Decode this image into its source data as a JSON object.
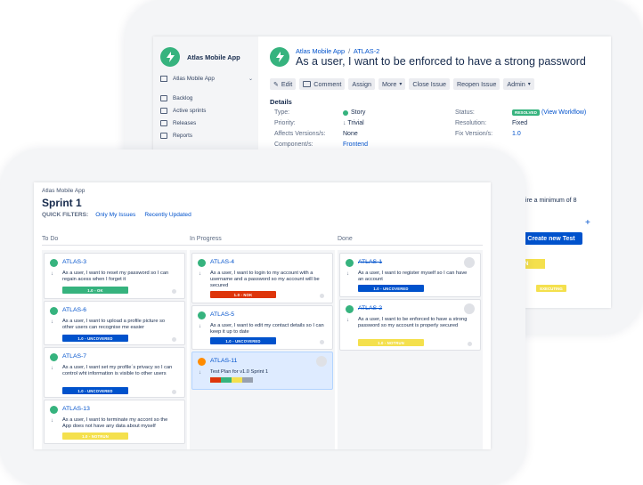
{
  "issue_view": {
    "project_name": "Atlas Mobile App",
    "sidebar": {
      "project_selector": "Atlas Mobile App",
      "items": [
        {
          "label": "Backlog",
          "icon": "backlog-icon"
        },
        {
          "label": "Active sprints",
          "icon": "board-icon"
        },
        {
          "label": "Releases",
          "icon": "ship-icon"
        },
        {
          "label": "Reports",
          "icon": "chart-icon"
        }
      ]
    },
    "breadcrumb": {
      "project": "Atlas Mobile App",
      "separator": "/",
      "issue_key": "ATLAS-2"
    },
    "title": "As a user, I want to be enforced to have a strong password",
    "toolbar": {
      "edit": "Edit",
      "comment": "Comment",
      "assign": "Assign",
      "more": "More",
      "close_issue": "Close Issue",
      "reopen_issue": "Reopen Issue",
      "admin": "Admin"
    },
    "details_heading": "Details",
    "details": {
      "type_label": "Type:",
      "type_value": "Story",
      "priority_label": "Priority:",
      "priority_value": "Trivial",
      "affects_label": "Affects Versions/s:",
      "affects_value": "None",
      "component_label": "Component/s:",
      "component_value": "Frontend",
      "status_label": "Status:",
      "status_badge": "RESOLVED",
      "status_link": "(View Workflow)",
      "resolution_label": "Resolution:",
      "resolution_value": "Fixed",
      "fix_label": "Fix Version/s:",
      "fix_value": "1.0"
    },
    "partial": {
      "text_fragment": "uire a minimum of 8",
      "plus": "+",
      "create_test_button": "Create new Test",
      "badge_fragment": "UN",
      "executing_badge": "EXECUTING"
    }
  },
  "board": {
    "project_name": "Atlas Mobile App",
    "sprint_title": "Sprint 1",
    "quick_filters_label": "QUICK FILTERS:",
    "filters": [
      "Only My Issues",
      "Recently Updated"
    ],
    "columns": [
      {
        "title": "To Do",
        "cards": [
          {
            "key": "ATLAS-3",
            "summary": "As a user, I want to reset my password so I can regain acess when I forget it",
            "version": "1.0 - OK",
            "version_color": "#36b37e",
            "status_color": "#36b37e"
          },
          {
            "key": "ATLAS-6",
            "summary": "As a user, I want to upload a profile picture so other users can recognise me easier",
            "version": "1.0 - UNCOVERED",
            "version_color": "#0052cc",
            "status_color": "#36b37e"
          },
          {
            "key": "ATLAS-7",
            "summary": "As a user, I want set my profile´s privacy so I can control wht information is visible to other users",
            "version": "1.0 - UNCOVERED",
            "version_color": "#0052cc",
            "status_color": "#36b37e"
          },
          {
            "key": "ATLAS-13",
            "summary": "As a user, I want to terminate my accont so the App does not have any data about myself",
            "version": "1.0 - NOTRUN",
            "version_color": "#f4e04d",
            "status_color": "#36b37e"
          }
        ]
      },
      {
        "title": "In Progress",
        "cards": [
          {
            "key": "ATLAS-4",
            "summary": "As a user, I want to login to my account with a username and a password so my account will be secured",
            "version": "1.0 - NOK",
            "version_color": "#de350b",
            "status_color": "#36b37e"
          },
          {
            "key": "ATLAS-5",
            "summary": "As a user, I want to edit my contact details so I can keep it up to date",
            "version": "1.0 - UNCOVERED",
            "version_color": "#0052cc",
            "status_color": "#36b37e"
          },
          {
            "key": "ATLAS-11",
            "summary": "Test Plan for v1.0 Sprint 1",
            "status_color": "#ff8b00",
            "segments": [
              "#de350b",
              "#36b37e",
              "#f4e04d",
              "#97a0af"
            ]
          }
        ]
      },
      {
        "title": "Done",
        "cards": [
          {
            "key": "ATLAS-1",
            "summary": "As a user, I want to register myself so I can have an account",
            "version": "1.0 - UNCOVERED",
            "version_color": "#0052cc",
            "status_color": "#36b37e"
          },
          {
            "key": "ATLAS-2",
            "summary": "As a user, I want to be enforced to have a strong password so my account is properly secured",
            "version": "1.0 - NOTRUN",
            "version_color": "#f4e04d",
            "status_color": "#36b37e"
          }
        ]
      }
    ]
  }
}
